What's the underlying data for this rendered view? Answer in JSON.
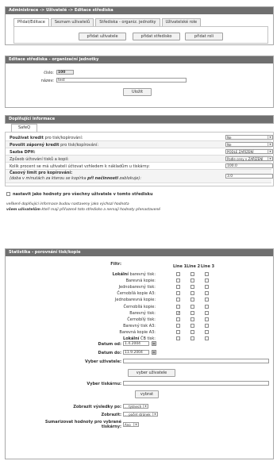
{
  "admin": {
    "title": "Administrace -> Uživatelé -> Editace střediska",
    "tabs": [
      {
        "label": "Přidat/Editace"
      },
      {
        "label": "Seznam uživatelů"
      },
      {
        "label": "Střediska - organiz. jednotky"
      },
      {
        "label": "Uživatelské role"
      }
    ],
    "buttons": {
      "add_user": "přidat uživatele",
      "add_center": "přidat středisko",
      "add_role": "přidat roli"
    }
  },
  "edit": {
    "title": "Editace střediska - organizační jednotky",
    "number_label": "číslo:",
    "number_value": "100",
    "name_label": "název:",
    "name_value": "test",
    "save": "Uložit"
  },
  "extra": {
    "title": "Doplňující informace",
    "tab": "SafeQ",
    "rows": [
      {
        "label_bold": "Používat kredit",
        "label_rest": " pro tisk/kopírování:",
        "value": "Ne"
      },
      {
        "label_bold": "Povolit záporný kredit",
        "label_rest": " pro tisk/kopírování:",
        "value": "Ne"
      },
      {
        "label_bold": "Sazba DPH:",
        "label_rest": "",
        "value": "PODLE ZAŘÍZENÍ"
      },
      {
        "label_bold": "",
        "label_rest": "Způsob účtování tisků a kopií:",
        "value": "Podle ceny v ZAŘÍZENÍ"
      },
      {
        "label_bold": "",
        "label_rest": "Kolik procent se má uživateli účtovat vzhledem k nákladům u tiskárny:",
        "value": "100.0"
      }
    ],
    "time_label_bold": "Časový limit pro kopírování:",
    "time_label_sub": "(doba v minutách za kterou se kopírka ",
    "time_label_sub_bold": "při nečinnosti",
    "time_label_sub_end": " zablokuje):",
    "time_value": "3.0",
    "default_check_label": "nastavit jako hodnoty pro všechny uživatele v tomto středisku",
    "note_line1": "veškeré doplňující informace budou nastaveny jako výchozí hodnota",
    "note_line2_bold": "všem uživatelům",
    "note_line2_rest": " kteří mají přiřazené toto středisko a nemají hodnoty přenastavené"
  },
  "stats": {
    "title": "Statistika - porovnání tisk/kopie",
    "filter_label": "Filtr:",
    "columns": [
      "Line 1",
      "Line 2",
      "Line 3"
    ],
    "filters": [
      {
        "bold": "Lokální",
        "rest": " barevný tisk:",
        "checks": [
          false,
          false,
          false
        ]
      },
      {
        "bold": "",
        "rest": "Barevná kopie:",
        "checks": [
          false,
          false,
          false
        ]
      },
      {
        "bold": "",
        "rest": "Jednobarevný tisk:",
        "checks": [
          false,
          false,
          false
        ]
      },
      {
        "bold": "",
        "rest": "Černobílá kopie A3:",
        "checks": [
          false,
          false,
          false
        ]
      },
      {
        "bold": "",
        "rest": "Jednobarevná kopie:",
        "checks": [
          false,
          false,
          false
        ]
      },
      {
        "bold": "",
        "rest": "Černobílá kopie:",
        "checks": [
          false,
          false,
          false
        ]
      },
      {
        "bold": "",
        "rest": "Barevný tisk:",
        "checks": [
          true,
          false,
          false
        ]
      },
      {
        "bold": "",
        "rest": "Černobílý tisk:",
        "checks": [
          false,
          false,
          false
        ]
      },
      {
        "bold": "",
        "rest": "Barevný tisk A3:",
        "checks": [
          false,
          false,
          false
        ]
      },
      {
        "bold": "",
        "rest": "Barevná kopie A3:",
        "checks": [
          false,
          false,
          false
        ]
      },
      {
        "bold": "Lokální",
        "rest": " ČB tisk:",
        "checks": [
          false,
          false,
          false
        ]
      }
    ],
    "date_from_label": "Datum od:",
    "date_from": "1.4.2004",
    "date_to_label": "Datum do:",
    "date_to": "11.9.2004",
    "user_label": "Vyber uživatele:",
    "user_button": "vyber uživatele",
    "printer_label": "Vyber tiskárnu:",
    "printer_button": "vybrat",
    "show_by_label": "Zobrazit výsledky po:",
    "show_by_value": "... týdnech",
    "show_label": "Zobrazit:",
    "show_value": "... počet stránek",
    "sum_label_1": "Sumarizovat hodnoty pro vybrané",
    "sum_label_2": "tiskárny:",
    "sum_value": "Ano"
  }
}
